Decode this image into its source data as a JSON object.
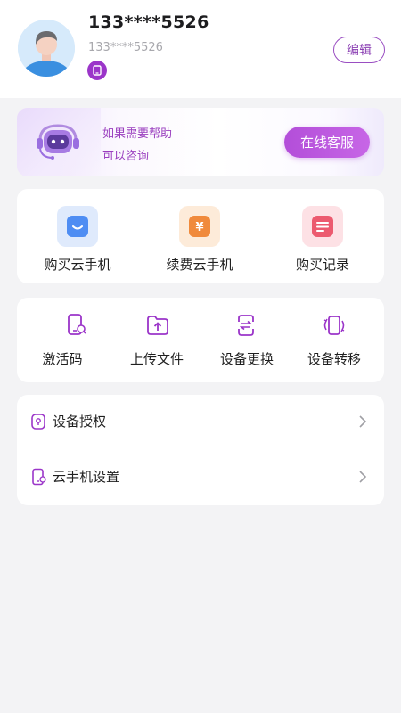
{
  "user": {
    "phone_display": "133****5526",
    "phone_sub": "133****5526",
    "edit_label": "编辑"
  },
  "help": {
    "line1": "如果需要帮助",
    "line2": "可以咨询",
    "service_button": "在线客服"
  },
  "shop": {
    "items": [
      {
        "label": "购买云手机",
        "icon": "bag-icon",
        "color": "#4e8df3"
      },
      {
        "label": "续费云手机",
        "icon": "yen-icon",
        "color": "#f08a3c"
      },
      {
        "label": "购买记录",
        "icon": "list-icon",
        "color": "#ec5a6f"
      }
    ]
  },
  "tools": {
    "items": [
      {
        "label": "激活码",
        "icon": "activation-code-icon"
      },
      {
        "label": "上传文件",
        "icon": "upload-folder-icon"
      },
      {
        "label": "设备更换",
        "icon": "device-swap-icon"
      },
      {
        "label": "设备转移",
        "icon": "device-transfer-icon"
      }
    ]
  },
  "settings": {
    "rows": [
      {
        "label": "设备授权",
        "icon": "authorization-icon"
      },
      {
        "label": "云手机设置",
        "icon": "phone-settings-icon"
      }
    ]
  },
  "colors": {
    "accent": "#9b35c9",
    "background": "#f3f3f5"
  }
}
